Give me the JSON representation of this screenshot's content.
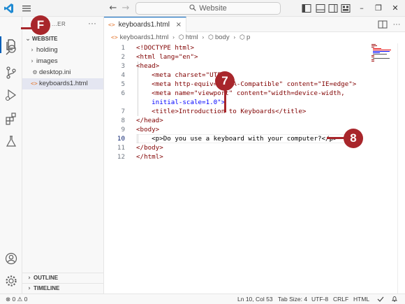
{
  "titlebar": {
    "search_text": "Website",
    "back_arrow": "←",
    "forward_arrow": "→",
    "minimize": "–",
    "restore": "❐",
    "close": "✕"
  },
  "activity_bar": {
    "icons": [
      "explorer-icon",
      "search-icon",
      "source-control-icon",
      "run-debug-icon",
      "extensions-icon",
      "testing-icon",
      "account-icon",
      "settings-gear-icon"
    ]
  },
  "sidebar": {
    "header": "...ER",
    "more": "···",
    "section": "WEBSITE",
    "items": [
      {
        "label": "holding",
        "type": "folder",
        "chevron": "›"
      },
      {
        "label": "images",
        "type": "folder",
        "chevron": "›"
      },
      {
        "label": "desktop.ini",
        "type": "file"
      },
      {
        "label": "keyboards1.html",
        "type": "html",
        "icon": "<>"
      }
    ],
    "outline": "OUTLINE",
    "timeline": "TIMELINE"
  },
  "editor": {
    "tab_label": "keyboards1.html",
    "tab_icon": "<>",
    "tab_close": "×",
    "breadcrumb": [
      "keyboards1.html",
      "html",
      "body",
      "p"
    ],
    "line_numbers": [
      "1",
      "2",
      "3",
      "4",
      "5",
      "6",
      "7",
      "8",
      "9",
      "10",
      "11",
      "12"
    ],
    "current_line": "10",
    "lines": [
      "<!DOCTYPE html>",
      "<html lang=\"en\">",
      "<head>",
      "    <meta charset=\"UTF",
      "    <meta http-equiv=\"X-UA-Compatible\" content=\"IE=edge\">",
      "    <meta name=\"viewport\" content=\"width=device-width,",
      "    initial-scale=1.0\">",
      "    <title>Introduction to Keyboards</title>",
      "</head>",
      "<body>",
      "    <p>Do you use a keyboard with your computer?</p>",
      "</body>",
      "</html>"
    ]
  },
  "statusbar": {
    "errors": "0",
    "warnings": "0",
    "position": "Ln 10, Col 53",
    "tab_size": "Tab Size: 4",
    "encoding": "UTF-8",
    "eol": "CRLF",
    "language": "HTML"
  },
  "callouts": {
    "f": "F",
    "seven": "7",
    "eight": "8"
  },
  "colors": {
    "accent": "#005fb8",
    "callout": "#a8262b",
    "tag": "#800000",
    "attribute": "#e50000",
    "string": "#0000ff"
  }
}
